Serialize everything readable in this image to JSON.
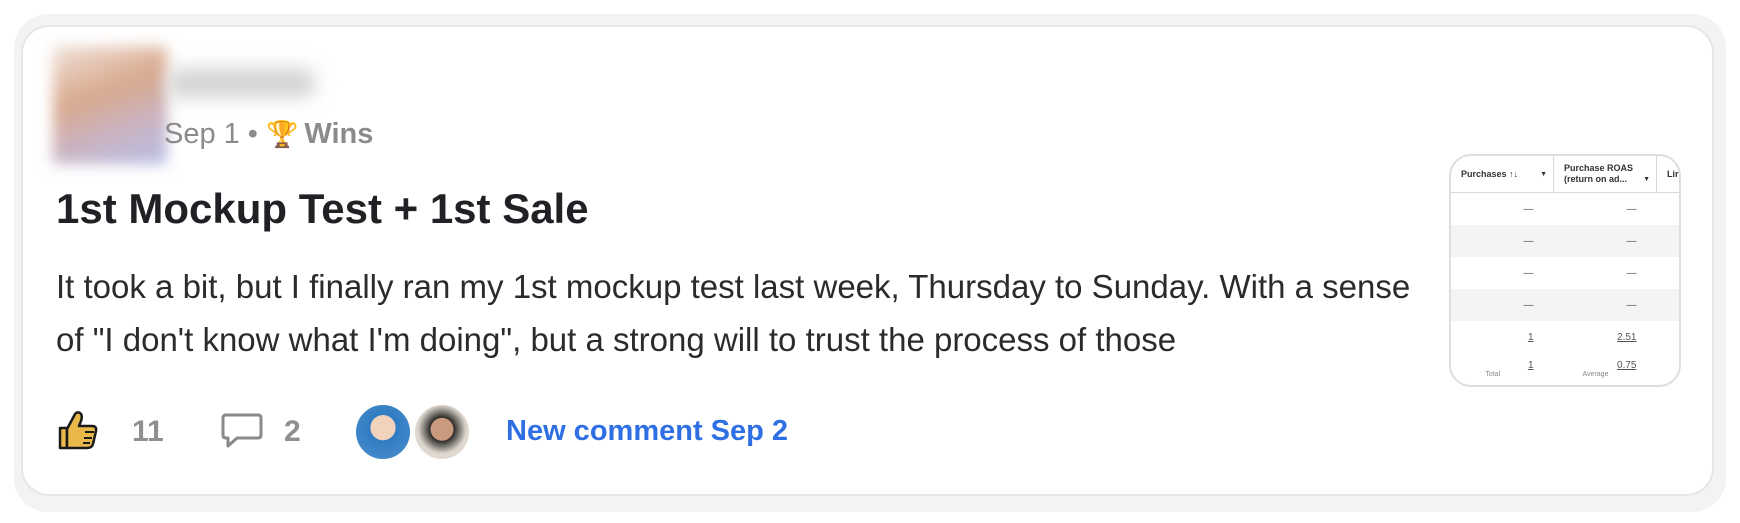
{
  "post": {
    "date": "Sep 1",
    "separator": "•",
    "category_icon": "🏆",
    "category": "Wins",
    "title": "1st Mockup Test + 1st Sale",
    "excerpt": "It took a bit, but I finally ran my 1st mockup test last week, Thursday to Sunday. With a sense of \"I don't know what I'm doing\", but a strong will to trust the process of those"
  },
  "footer": {
    "like_count": "11",
    "comment_count": "2",
    "new_comment": "New comment Sep 2"
  },
  "thumbnail_table": {
    "headers": [
      "Purchases ↑↓",
      "Purchase ROAS (return on ad...",
      "Lir"
    ],
    "rows": [
      [
        "—",
        "—"
      ],
      [
        "—",
        "—"
      ],
      [
        "—",
        "—"
      ],
      [
        "—",
        "—"
      ],
      [
        "1",
        "2.51"
      ]
    ],
    "totals": [
      "1",
      "0.75"
    ],
    "total_labels": [
      "Total",
      "Average"
    ]
  },
  "colors": {
    "accent": "#2f6fe4",
    "like_icon": "#e9b84a",
    "muted_text": "#8f8f8f"
  }
}
